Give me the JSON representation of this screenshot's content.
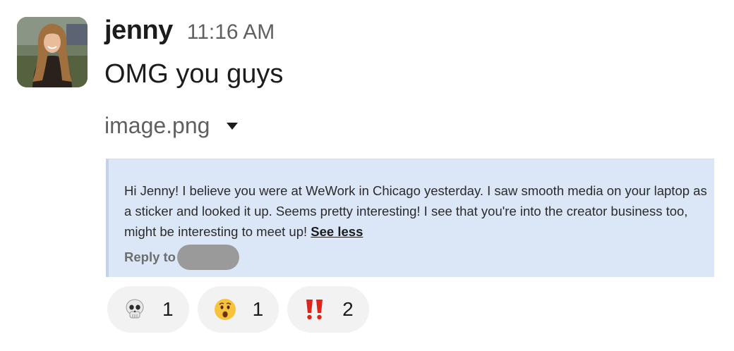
{
  "message": {
    "author": "jenny",
    "timestamp": "11:16 AM",
    "text": "OMG you guys"
  },
  "attachment": {
    "filename": "image.png",
    "image_text": {
      "body": "Hi Jenny! I believe you were at WeWork in Chicago yesterday. I saw smooth media on your laptop as a sticker and looked it up. Seems pretty interesting! I see that you're into the creator business too, might be interesting to meet up! ",
      "see_less": "See less",
      "reply_label": "Reply to"
    }
  },
  "reactions": [
    {
      "emoji": "skull-icon",
      "count": "1"
    },
    {
      "emoji": "hushed-face-icon",
      "count": "1"
    },
    {
      "emoji": "double-exclamation-icon",
      "count": "2"
    }
  ],
  "colors": {
    "image_background": "#dbe6f7",
    "reaction_background": "#f2f2f2",
    "timestamp": "#616061"
  }
}
